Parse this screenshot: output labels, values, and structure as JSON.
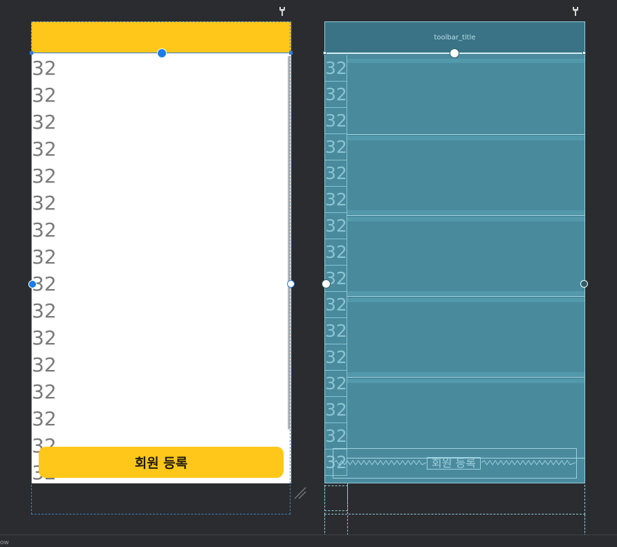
{
  "design_view": {
    "toolbar_color": "#ffc719",
    "list_items": [
      "32",
      "32",
      "32",
      "32",
      "32",
      "32",
      "32",
      "32",
      "32",
      "32",
      "32",
      "32",
      "32",
      "32",
      "32",
      "32"
    ],
    "register_button_label": "회원 등록",
    "accent_color": "#1a7ee6"
  },
  "blueprint_view": {
    "toolbar_title": "toolbar_title",
    "list_items": [
      "32",
      "32",
      "32",
      "32",
      "32",
      "32",
      "32",
      "32",
      "32",
      "32",
      "32",
      "32",
      "32",
      "32",
      "32",
      "32"
    ],
    "register_button_label": "회원 등록",
    "background_color": "#4a8a9d"
  },
  "icons": {
    "design_wrench": "wrench-icon",
    "blueprint_wrench": "wrench-icon",
    "resize": "resize-handle-icon"
  },
  "status_bar": {
    "label": "ow"
  }
}
